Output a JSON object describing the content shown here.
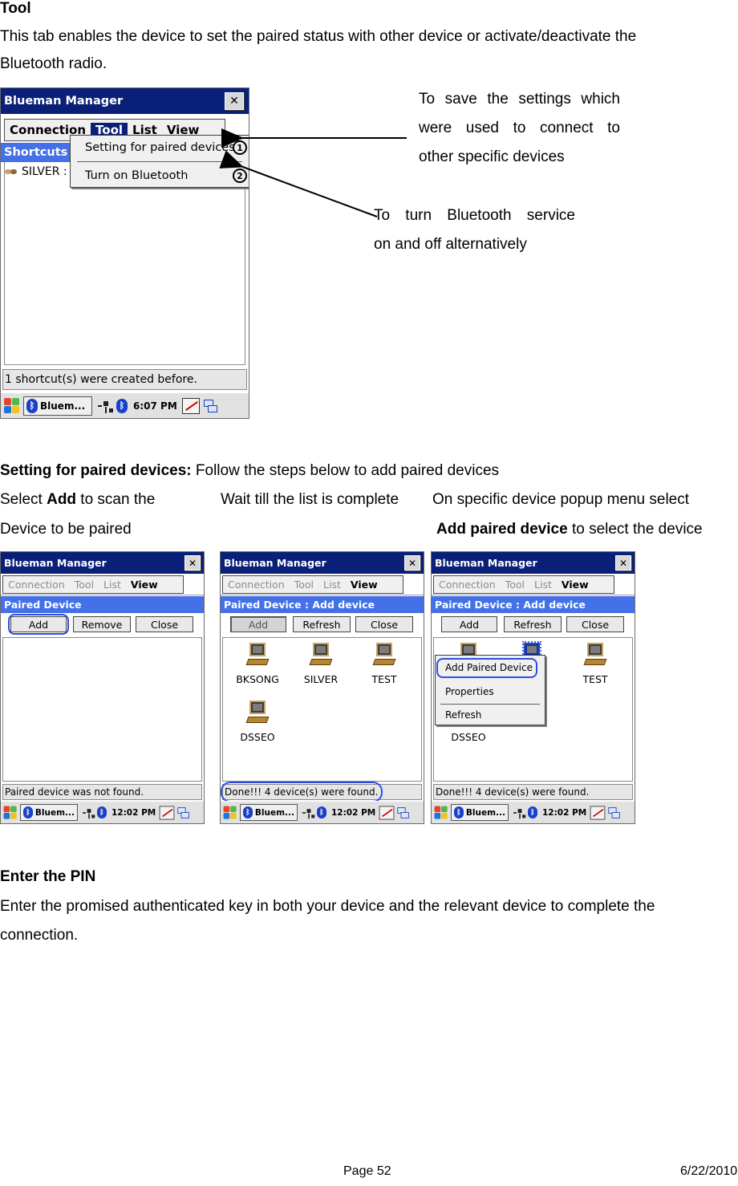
{
  "section_tool": {
    "heading": "Tool",
    "line1": "This tab enables the device to set the paired status with other device or activate/deactivate the",
    "line2": "Bluetooth radio."
  },
  "callouts": {
    "c1_l1": "To save the settings which",
    "c1_l2": "were used to connect to",
    "c1_l3": "other specific devices",
    "c2_l1": "To turn Bluetooth service",
    "c2_l2": "on and off alternatively"
  },
  "screen_tool": {
    "title": "Blueman Manager",
    "close": "✕",
    "menu": [
      "Connection",
      "Tool",
      "List",
      "View"
    ],
    "header_label": "Shortcuts",
    "list_item": "SILVER :",
    "dropdown_item1": "Setting for paired devices",
    "dropdown_item2": "Turn on Bluetooth",
    "num1": "1",
    "num2": "2",
    "status": "1 shortcut(s) were created before.",
    "task": "Bluem...",
    "time": "6:07 PM"
  },
  "section_paired": {
    "heading_bold": "Setting for paired devices:",
    "heading_rest": " Follow the steps below to add paired devices",
    "step1_pre": "Select ",
    "step1_bold": "Add",
    "step1_post": " to scan the",
    "step1_line2": "Device to be paired",
    "step2": "Wait till the list is complete",
    "step3_line1": "On specific device popup menu select",
    "step3_bold": "Add paired device",
    "step3_post": " to select the device"
  },
  "screen_a": {
    "title": "Blueman Manager",
    "close": "✕",
    "menu": [
      "Connection",
      "Tool",
      "List",
      "View"
    ],
    "header_label": "Paired Device",
    "buttons": [
      "Add",
      "Remove",
      "Close"
    ],
    "status": "Paired device was not found.",
    "task": "Bluem...",
    "time": "12:02 PM"
  },
  "screen_b": {
    "title": "Blueman Manager",
    "close": "✕",
    "menu": [
      "Connection",
      "Tool",
      "List",
      "View"
    ],
    "header_label": "Paired Device : Add device",
    "buttons": [
      "Add",
      "Refresh",
      "Close"
    ],
    "devices": [
      "BKSONG",
      "SILVER",
      "TEST",
      "DSSEO"
    ],
    "status": "Done!!! 4 device(s) were found.",
    "task": "Bluem...",
    "time": "12:02 PM"
  },
  "screen_c": {
    "title": "Blueman Manager",
    "close": "✕",
    "menu": [
      "Connection",
      "Tool",
      "List",
      "View"
    ],
    "header_label": "Paired Device : Add device",
    "buttons": [
      "Add",
      "Refresh",
      "Close"
    ],
    "devices": [
      "TEST",
      "DSSEO"
    ],
    "popup": [
      "Add Paired Device",
      "Properties",
      "Refresh"
    ],
    "status": "Done!!! 4 device(s) were found.",
    "task": "Bluem...",
    "time": "12:02 PM"
  },
  "section_pin": {
    "heading": "Enter the PIN",
    "line1": "Enter the promised authenticated key in both your device and the relevant device to complete the",
    "line2": "connection."
  },
  "footer": {
    "page": "Page 52",
    "date": "6/22/2010"
  }
}
